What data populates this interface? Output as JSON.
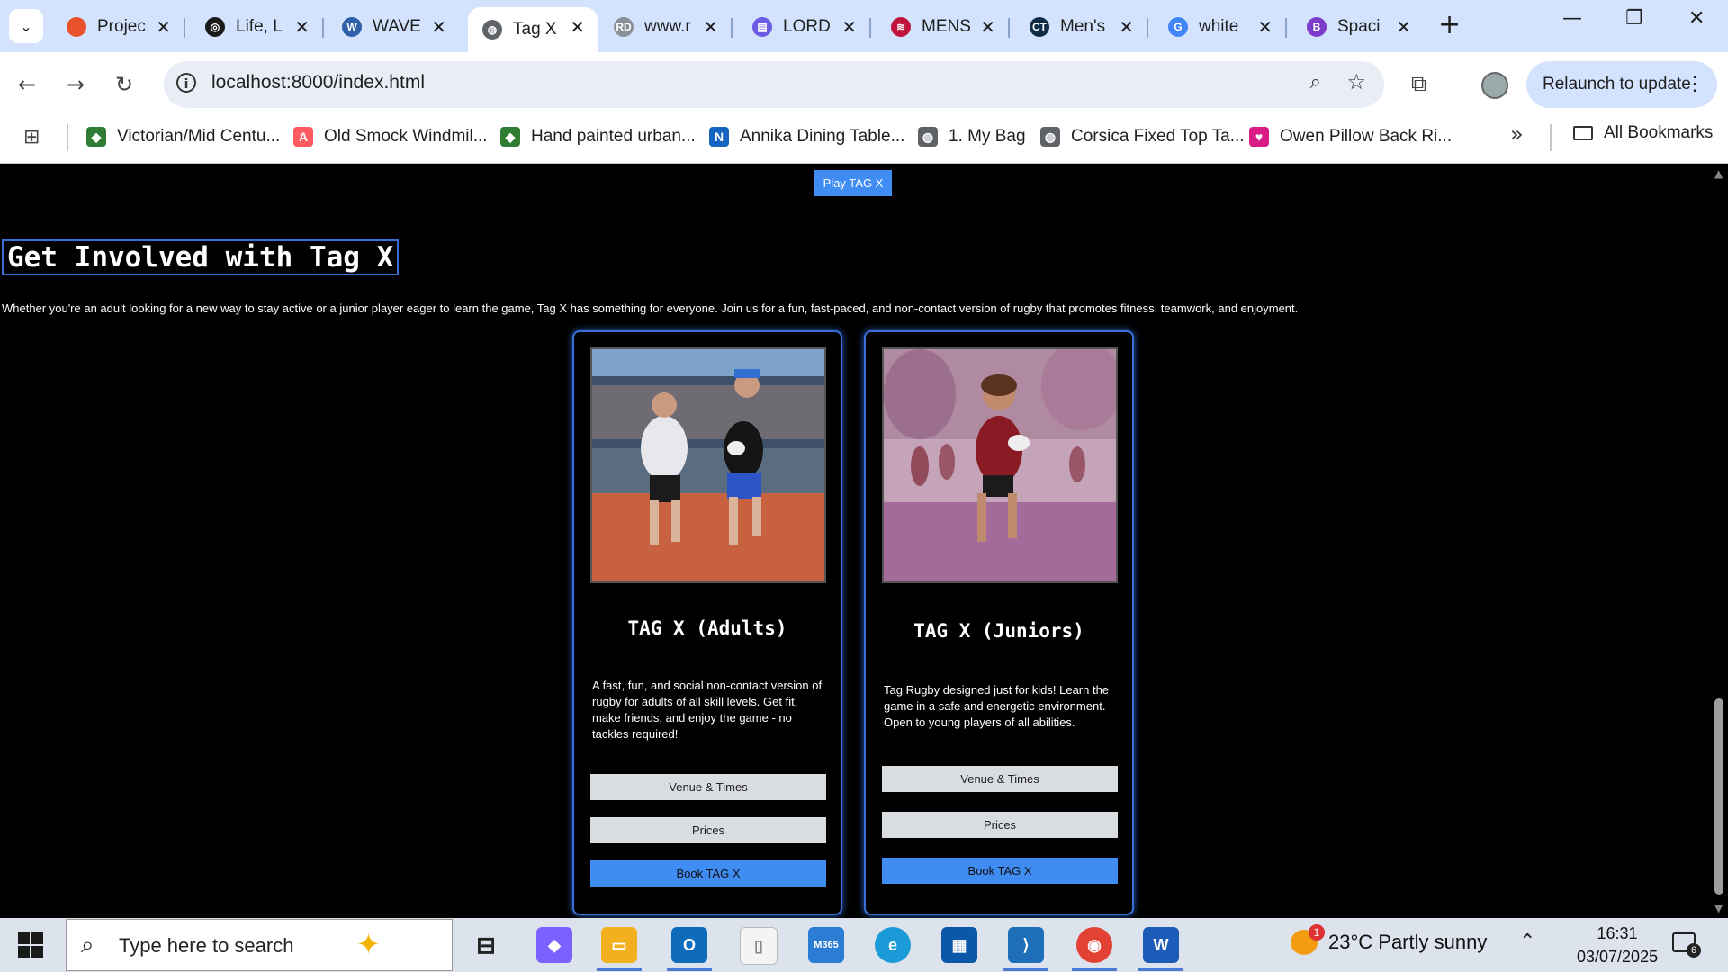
{
  "browser": {
    "tabs": [
      {
        "title": "Projec",
        "icon": "opera-circle-icon",
        "color": "#e8532b",
        "glyph": "",
        "active": false
      },
      {
        "title": "Life, L",
        "icon": "openai-icon",
        "color": "#1a1a1a",
        "glyph": "◎",
        "active": false
      },
      {
        "title": "WAVE",
        "icon": "wordpress-icon",
        "color": "#2f5fa8",
        "glyph": "W",
        "active": false
      },
      {
        "title": "Tag X",
        "icon": "globe-icon",
        "color": "#5f6368",
        "glyph": "◍",
        "active": true
      },
      {
        "title": "www.r",
        "icon": "rd-icon",
        "color": "#8a8f98",
        "glyph": "RD",
        "active": false
      },
      {
        "title": "LORD",
        "icon": "printer-icon",
        "color": "#6a5be2",
        "glyph": "▤",
        "active": false
      },
      {
        "title": "MENS",
        "icon": "brand-icon",
        "color": "#c0143c",
        "glyph": "≋",
        "active": false
      },
      {
        "title": "Men's",
        "icon": "ct-icon",
        "color": "#0d2b45",
        "glyph": "CT",
        "active": false
      },
      {
        "title": "white",
        "icon": "google-icon",
        "color": "#4285f4",
        "glyph": "G",
        "active": false
      },
      {
        "title": "Spaci",
        "icon": "bootstrap-icon",
        "color": "#7a3cc9",
        "glyph": "B",
        "active": false
      }
    ],
    "url": "localhost:8000/index.html",
    "relaunch_label": "Relaunch to update",
    "bookmarks": [
      {
        "label": "Victorian/Mid Centu...",
        "icon": "leaf-icon",
        "color": "#2e7d32",
        "glyph": "◆"
      },
      {
        "label": "Old Smock Windmil...",
        "icon": "airbnb-icon",
        "color": "#ff5a5f",
        "glyph": "A"
      },
      {
        "label": "Hand painted urban...",
        "icon": "leaf-icon",
        "color": "#2e7d32",
        "glyph": "◆"
      },
      {
        "label": "Annika Dining Table...",
        "icon": "n-brand-icon",
        "color": "#1565c0",
        "glyph": "N"
      },
      {
        "label": "1. My Bag",
        "icon": "globe-icon",
        "color": "#5f6368",
        "glyph": "◍"
      },
      {
        "label": "Corsica Fixed Top Ta...",
        "icon": "globe-icon",
        "color": "#5f6368",
        "glyph": "◍"
      },
      {
        "label": "Owen Pillow Back Ri...",
        "icon": "heart-icon",
        "color": "#d81b87",
        "glyph": "♥"
      }
    ],
    "all_bookmarks_label": "All Bookmarks"
  },
  "page": {
    "play_button_label": "Play TAG X",
    "section_title": "Get Involved with Tag X",
    "intro_text": "Whether you're an adult looking for a new way to stay active or a junior player eager to learn the game, Tag X has something for everyone. Join us for a fun, fast-paced, and non-contact version of rugby that promotes fitness, teamwork, and enjoyment.",
    "cards": [
      {
        "title": "TAG X (Adults)",
        "description": "A fast, fun, and social non-contact version of rugby for adults of all skill levels. Get fit, make friends, and enjoy the game - no tackles required!",
        "venue_label": "Venue & Times",
        "prices_label": "Prices",
        "book_label": "Book TAG X"
      },
      {
        "title": "TAG X (Juniors)",
        "description": "Tag Rugby designed just for kids! Learn the game in a safe and energetic environment. Open to young players of all abilities.",
        "venue_label": "Venue & Times",
        "prices_label": "Prices",
        "book_label": "Book TAG X"
      }
    ]
  },
  "taskbar": {
    "search_placeholder": "Type here to search",
    "weather": "23°C  Partly sunny",
    "weather_badge": "1",
    "time": "16:31",
    "date": "03/07/2025",
    "notification_count": "6"
  }
}
